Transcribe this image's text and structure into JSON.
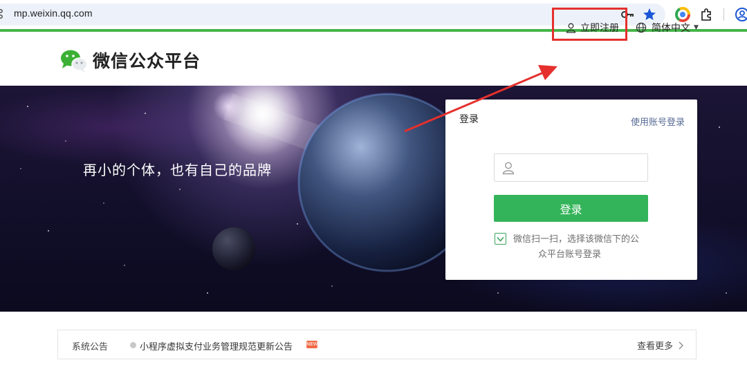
{
  "browser": {
    "url": "mp.weixin.qq.com",
    "icons": [
      "site-info-icon",
      "password-key-icon",
      "bookmark-star-icon",
      "chrome-extension-color-icon",
      "extensions-puzzle-icon",
      "profile-avatar-icon"
    ]
  },
  "header": {
    "logo_text": "微信公众平台",
    "register_label": "立即注册",
    "language_label": "简体中文"
  },
  "banner": {
    "slogan": "再小的个体，也有自己的品牌"
  },
  "login": {
    "title": "登录",
    "account_login_link": "使用账号登录",
    "account_placeholder": "",
    "button_label": "登录",
    "scan_hint_line1": "微信扫一扫，选择该微信下的公",
    "scan_hint_line2": "众平台账号登录",
    "scan_checked": true
  },
  "notice": {
    "label": "系统公告",
    "title": "小程序虚拟支付业务管理规范更新公告",
    "badge": "NEW",
    "view_more": "查看更多"
  },
  "colors": {
    "brand_green": "#44b549",
    "login_button": "#34b45a",
    "link_blue": "#576b95",
    "annotation_red": "#e5302d"
  }
}
